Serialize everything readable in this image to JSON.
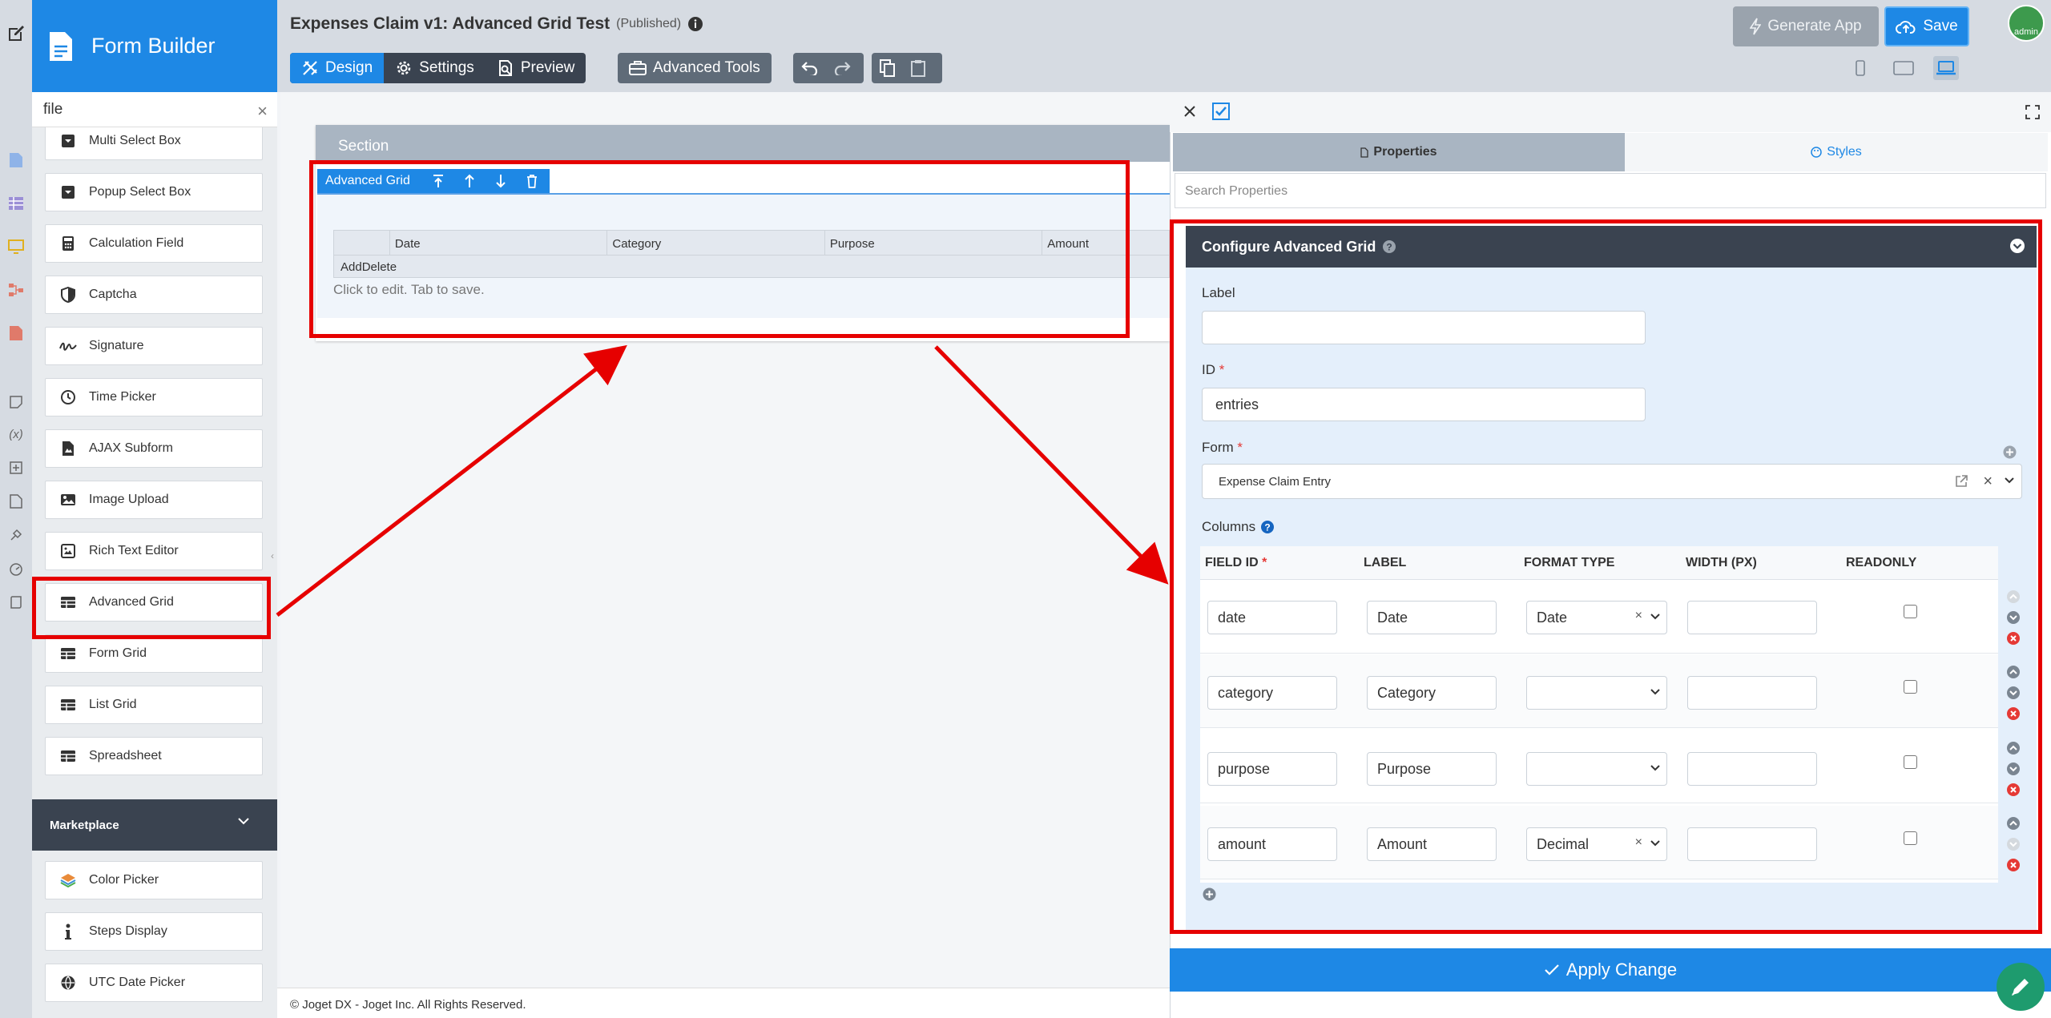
{
  "app": {
    "title": "Form Builder"
  },
  "search": {
    "value": "file"
  },
  "palette": {
    "items": [
      {
        "label": "Multi Select Box",
        "icon": "multi-select-icon"
      },
      {
        "label": "Popup Select Box",
        "icon": "popup-select-icon"
      },
      {
        "label": "Calculation Field",
        "icon": "calculator-icon"
      },
      {
        "label": "Captcha",
        "icon": "shield-icon"
      },
      {
        "label": "Signature",
        "icon": "signature-icon"
      },
      {
        "label": "Time Picker",
        "icon": "clock-icon"
      },
      {
        "label": "AJAX Subform",
        "icon": "subform-icon"
      },
      {
        "label": "Image Upload",
        "icon": "image-icon"
      },
      {
        "label": "Rich Text Editor",
        "icon": "rich-text-icon"
      },
      {
        "label": "Advanced Grid",
        "icon": "table-icon"
      },
      {
        "label": "Form Grid",
        "icon": "table-icon"
      },
      {
        "label": "List Grid",
        "icon": "table-icon"
      },
      {
        "label": "Spreadsheet",
        "icon": "table-icon"
      }
    ],
    "marketplace": {
      "label": "Marketplace",
      "items": [
        {
          "label": "Color Picker",
          "icon": "color-layers-icon"
        },
        {
          "label": "Steps Display",
          "icon": "info-icon"
        },
        {
          "label": "UTC Date Picker",
          "icon": "globe-icon"
        }
      ]
    }
  },
  "header": {
    "doc_title": "Expenses Claim v1: Advanced Grid Test",
    "status": "(Published)",
    "tabs": [
      {
        "label": "Design",
        "active": true
      },
      {
        "label": "Settings"
      },
      {
        "label": "Preview"
      }
    ],
    "advanced_tools": "Advanced Tools",
    "generate_app": "Generate App",
    "save": "Save",
    "avatar": "admin"
  },
  "canvas": {
    "section_label": "Section",
    "grid_label": "Advanced Grid",
    "grid_columns": [
      "Date",
      "Category",
      "Purpose",
      "Amount"
    ],
    "add_delete": "AddDelete",
    "hint": "Click to edit. Tab to save.",
    "footer": "© Joget DX - Joget Inc. All Rights Reserved."
  },
  "properties": {
    "tab_properties": "Properties",
    "tab_styles": "Styles",
    "search_placeholder": "Search Properties",
    "config_title": "Configure Advanced Grid",
    "label_field": {
      "label": "Label",
      "value": ""
    },
    "id_field": {
      "label": "ID",
      "value": "entries"
    },
    "form_field": {
      "label": "Form",
      "value": "Expense Claim Entry"
    },
    "columns_label": "Columns",
    "column_headers": [
      "FIELD ID",
      "LABEL",
      "FORMAT TYPE",
      "WIDTH (PX)",
      "READONLY"
    ],
    "rows": [
      {
        "field_id": "date",
        "label": "Date",
        "format": "Date",
        "width": "",
        "readonly": false
      },
      {
        "field_id": "category",
        "label": "Category",
        "format": "",
        "width": "",
        "readonly": false
      },
      {
        "field_id": "purpose",
        "label": "Purpose",
        "format": "",
        "width": "",
        "readonly": false
      },
      {
        "field_id": "amount",
        "label": "Amount",
        "format": "Decimal",
        "width": "",
        "readonly": false
      }
    ],
    "apply": "Apply Change"
  },
  "colors": {
    "primary": "#1e88e5",
    "dark": "#3a4350",
    "annotation": "#e60000"
  }
}
